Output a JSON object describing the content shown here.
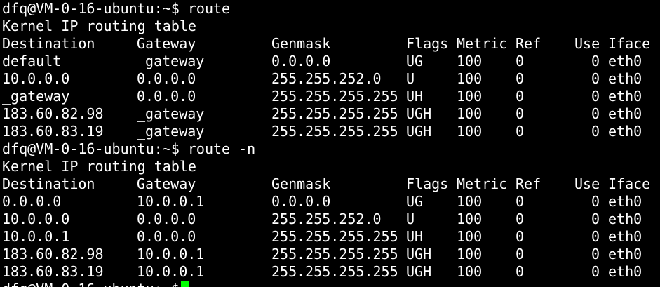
{
  "terminal": {
    "prompt": "dfq@VM-0-16-ubuntu:~$",
    "cursor_color": "#00ff00",
    "sessions": [
      {
        "command": "route",
        "table_title": "Kernel IP routing table",
        "headers": {
          "destination": "Destination",
          "gateway": "Gateway",
          "genmask": "Genmask",
          "flags": "Flags",
          "metric": "Metric",
          "ref": "Ref",
          "use": "Use",
          "iface": "Iface"
        },
        "rows": [
          {
            "destination": "default",
            "gateway": "_gateway",
            "genmask": "0.0.0.0",
            "flags": "UG",
            "metric": "100",
            "ref": "0",
            "use": "0",
            "iface": "eth0"
          },
          {
            "destination": "10.0.0.0",
            "gateway": "0.0.0.0",
            "genmask": "255.255.252.0",
            "flags": "U",
            "metric": "100",
            "ref": "0",
            "use": "0",
            "iface": "eth0"
          },
          {
            "destination": "_gateway",
            "gateway": "0.0.0.0",
            "genmask": "255.255.255.255",
            "flags": "UH",
            "metric": "100",
            "ref": "0",
            "use": "0",
            "iface": "eth0"
          },
          {
            "destination": "183.60.82.98",
            "gateway": "_gateway",
            "genmask": "255.255.255.255",
            "flags": "UGH",
            "metric": "100",
            "ref": "0",
            "use": "0",
            "iface": "eth0"
          },
          {
            "destination": "183.60.83.19",
            "gateway": "_gateway",
            "genmask": "255.255.255.255",
            "flags": "UGH",
            "metric": "100",
            "ref": "0",
            "use": "0",
            "iface": "eth0"
          }
        ]
      },
      {
        "command": "route -n",
        "table_title": "Kernel IP routing table",
        "headers": {
          "destination": "Destination",
          "gateway": "Gateway",
          "genmask": "Genmask",
          "flags": "Flags",
          "metric": "Metric",
          "ref": "Ref",
          "use": "Use",
          "iface": "Iface"
        },
        "rows": [
          {
            "destination": "0.0.0.0",
            "gateway": "10.0.0.1",
            "genmask": "0.0.0.0",
            "flags": "UG",
            "metric": "100",
            "ref": "0",
            "use": "0",
            "iface": "eth0"
          },
          {
            "destination": "10.0.0.0",
            "gateway": "0.0.0.0",
            "genmask": "255.255.252.0",
            "flags": "U",
            "metric": "100",
            "ref": "0",
            "use": "0",
            "iface": "eth0"
          },
          {
            "destination": "10.0.0.1",
            "gateway": "0.0.0.0",
            "genmask": "255.255.255.255",
            "flags": "UH",
            "metric": "100",
            "ref": "0",
            "use": "0",
            "iface": "eth0"
          },
          {
            "destination": "183.60.82.98",
            "gateway": "10.0.0.1",
            "genmask": "255.255.255.255",
            "flags": "UGH",
            "metric": "100",
            "ref": "0",
            "use": "0",
            "iface": "eth0"
          },
          {
            "destination": "183.60.83.19",
            "gateway": "10.0.0.1",
            "genmask": "255.255.255.255",
            "flags": "UGH",
            "metric": "100",
            "ref": "0",
            "use": "0",
            "iface": "eth0"
          }
        ]
      }
    ]
  }
}
